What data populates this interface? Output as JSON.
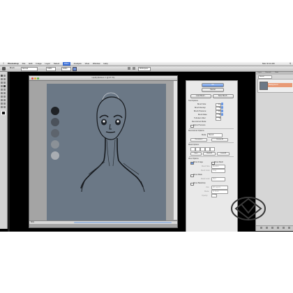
{
  "menubar": {
    "items": [
      "Photoshop",
      "File",
      "Edit",
      "Image",
      "Layer",
      "Select",
      "Filter",
      "Analysis",
      "View",
      "Window",
      "Help"
    ],
    "highlighted_index": 6,
    "clock": "Mon 9:11 AM"
  },
  "options_bar": {
    "tool_preset": "Brush:",
    "mode_value": "Normal",
    "opacity_value": "100%",
    "flow_value": "100%",
    "workspace_value": "Workspace"
  },
  "document": {
    "title": "Liquify (Retrieve: 1 @ 67.7%)",
    "zoom": "50%",
    "canvas_color": "#6b7886"
  },
  "liquify_panel": {
    "ok_label": "OK",
    "cancel_label": "Cancel",
    "load_mesh_label": "Load Mesh...",
    "save_mesh_label": "Save Mesh...",
    "tool_options_heading": "Tool Options",
    "brush_size_label": "Brush Size:",
    "brush_size_value": "600",
    "brush_density_label": "Brush Density:",
    "brush_density_value": "50",
    "brush_pressure_label": "Brush Pressure:",
    "brush_pressure_value": "100",
    "brush_rate_label": "Brush Rate:",
    "brush_rate_value": "80",
    "turbulent_jitter_label": "Turbulent Jitter:",
    "turbulent_jitter_value": "50",
    "reconstruct_mode_label": "Reconstruct Mode:",
    "stylus_pressure_label": "Stylus Pressure",
    "reconstruct_options_heading": "Reconstruct Options",
    "mode_label": "Mode:",
    "mode_value": "Revert",
    "reconstruct_label": "Reconstruct",
    "restore_all_label": "Restore All",
    "mask_options_heading": "Mask Options",
    "none_label": "None",
    "mask_all_label": "Mask All",
    "invert_all_label": "Invert All",
    "view_options_heading": "View Options",
    "show_image_label": "Show Image",
    "show_mesh_label": "Show Mesh",
    "mesh_size_label": "Mesh Size:",
    "mesh_size_value": "Medium",
    "mesh_color_label": "Mesh Color:",
    "mesh_color_value": "Gray",
    "show_mask_label": "Show Mask",
    "mask_color_label": "Mask Color:",
    "mask_color_value": "Red",
    "show_backdrop_label": "Show Backdrop",
    "use_label": "Use:",
    "use_value": "All Layers",
    "mode2_label": "Mode:",
    "mode2_value": "In Front",
    "opacity_label": "Opacity:",
    "opacity_value": "50"
  },
  "layers_panel": {
    "tabs": [
      "Layers",
      "Channels",
      "Paths"
    ],
    "blend_mode": "Normal",
    "selected_layer_name": "Background",
    "selected_color": "#e89a76"
  },
  "swatches": [
    {
      "color": "#1f2226",
      "label": "dark-swatch"
    },
    {
      "color": "#4b525b",
      "label": "mid-dark-swatch"
    },
    {
      "color": "#5d646d",
      "label": "mid-swatch"
    },
    {
      "color": "#8b9197",
      "label": "light-swatch"
    },
    {
      "color": "#a9adb2",
      "label": "lightest-swatch"
    }
  ]
}
